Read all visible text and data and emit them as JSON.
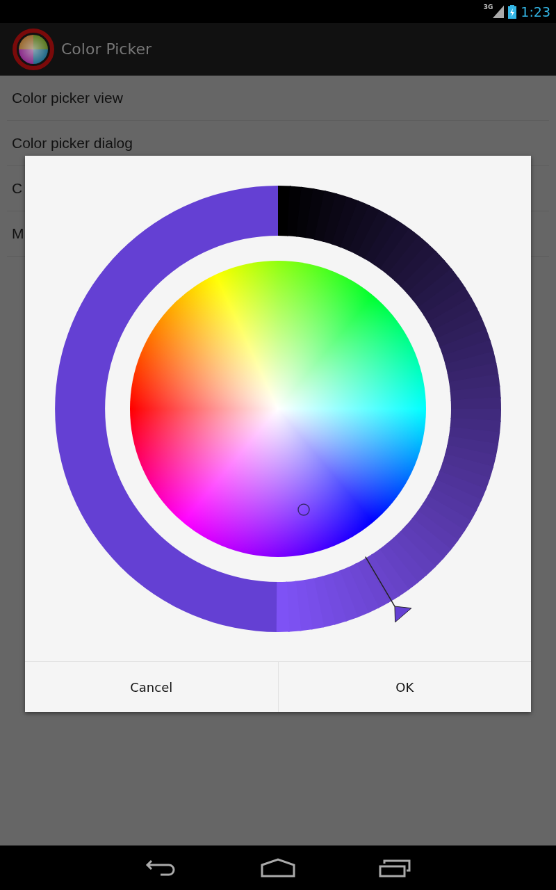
{
  "status_bar": {
    "network": "3G",
    "time": "1:23"
  },
  "app_bar": {
    "title": "Color Picker"
  },
  "list": [
    {
      "label": "Color picker view"
    },
    {
      "label": "Color picker dialog"
    },
    {
      "label": "C"
    },
    {
      "label": "M"
    }
  ],
  "dialog": {
    "buttons": [
      {
        "label": "Cancel"
      },
      {
        "label": "OK"
      }
    ]
  }
}
